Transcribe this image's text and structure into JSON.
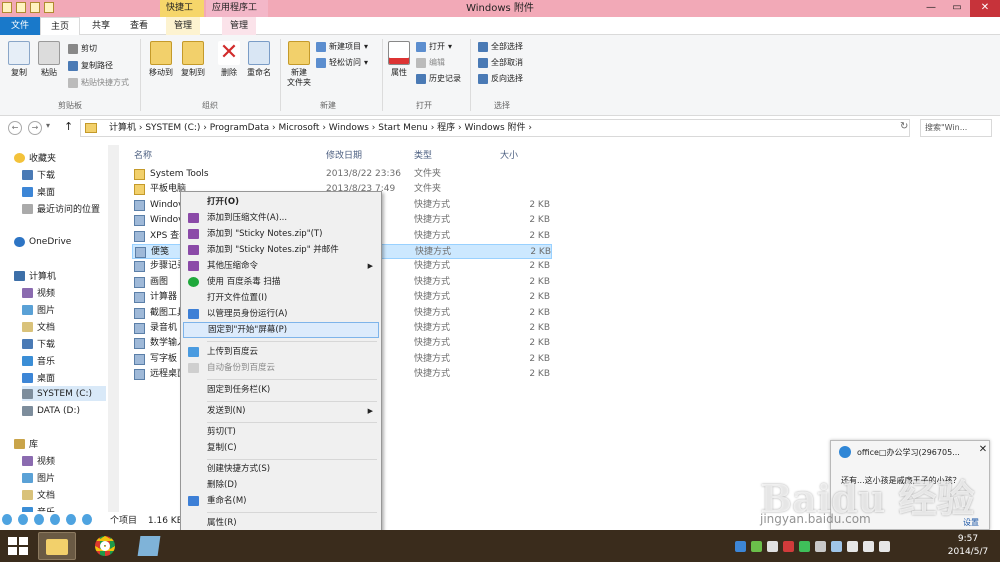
{
  "window": {
    "title": "Windows 附件",
    "context_tab_shortcut": "快捷工具",
    "context_tab_app": "应用程序工具",
    "minimize": "—",
    "restore": "▭",
    "close": "✕"
  },
  "tabs": [
    "文件",
    "主页",
    "共享",
    "查看",
    "管理",
    "管理"
  ],
  "ribbon": {
    "clipboard": {
      "copy": "复制",
      "paste": "粘贴",
      "cut": "剪切",
      "copy_path": "复制路径",
      "paste_shortcut": "粘贴快捷方式",
      "group": "剪贴板"
    },
    "organize": {
      "move_to": "移动到",
      "copy_to": "复制到",
      "delete": "删除",
      "rename": "重命名",
      "group": "组织"
    },
    "new": {
      "new_folder": "新建\n文件夹",
      "new_item": "新建项目",
      "easy_access": "轻松访问",
      "group": "新建"
    },
    "open": {
      "properties": "属性",
      "open": "打开",
      "edit": "编辑",
      "history": "历史记录",
      "group": "打开"
    },
    "select": {
      "select_all": "全部选择",
      "select_none": "全部取消",
      "invert": "反向选择",
      "group": "选择"
    }
  },
  "address": {
    "path": "计算机  ›  SYSTEM (C:)  ›  ProgramData  ›  Microsoft  ›  Windows  ›  Start Menu  ›  程序  ›  Windows 附件  ›",
    "search_placeholder": "搜索\"Win..."
  },
  "nav": {
    "favorites": "收藏夹",
    "downloads": "下载",
    "desktop": "桌面",
    "recent": "最近访问的位置",
    "onedrive": "OneDrive",
    "computer": "计算机",
    "videos": "视频",
    "pictures": "图片",
    "documents": "文档",
    "downloads2": "下载",
    "music": "音乐",
    "desktop2": "桌面",
    "system_c": "SYSTEM (C:)",
    "data_d": "DATA (D:)",
    "library": "库",
    "lib_videos": "视频",
    "lib_pictures": "图片",
    "lib_documents": "文档",
    "lib_music": "音乐"
  },
  "columns": {
    "name": "名称",
    "date": "修改日期",
    "type": "类型",
    "size": "大小"
  },
  "files": [
    {
      "name": "System Tools",
      "date": "2013/8/22 23:36",
      "type": "文件夹",
      "size": ""
    },
    {
      "name": "平板电脑",
      "date": "2013/8/23 7:49",
      "type": "文件夹",
      "size": ""
    },
    {
      "name": "Windov",
      "date": ":45",
      "type": "快捷方式",
      "size": "2 KB"
    },
    {
      "name": "Windov",
      "date": ":00",
      "type": "快捷方式",
      "size": "2 KB"
    },
    {
      "name": "XPS 查看",
      "date": ":56",
      "type": "快捷方式",
      "size": "2 KB"
    },
    {
      "name": "便笺",
      "date": ":46",
      "type": "快捷方式",
      "size": "2 KB"
    },
    {
      "name": "步骤记录",
      "date": ":52",
      "type": "快捷方式",
      "size": "2 KB"
    },
    {
      "name": "画图",
      "date": ":45",
      "type": "快捷方式",
      "size": "2 KB"
    },
    {
      "name": "计算器",
      "date": ":47",
      "type": "快捷方式",
      "size": "2 KB"
    },
    {
      "name": "截图工具",
      "date": ":01",
      "type": "快捷方式",
      "size": "2 KB"
    },
    {
      "name": "录音机",
      "date": ":52",
      "type": "快捷方式",
      "size": "2 KB"
    },
    {
      "name": "数学输入",
      "date": ":46",
      "type": "快捷方式",
      "size": "2 KB"
    },
    {
      "name": "写字板",
      "date": ":47",
      "type": "快捷方式",
      "size": "2 KB"
    },
    {
      "name": "远程桌面",
      "date": ":46",
      "type": "快捷方式",
      "size": "2 KB"
    }
  ],
  "status": {
    "count": "个项目",
    "selected": "1.16 KB"
  },
  "context_menu": {
    "open": "打开(O)",
    "add_archive": "添加到压缩文件(A)...",
    "add_zip": "添加到 \"Sticky Notes.zip\"(T)",
    "add_zip_mail": "添加到 \"Sticky Notes.zip\" 并邮件",
    "other_compress": "其他压缩命令",
    "baidu_scan": "使用 百度杀毒 扫描",
    "open_location": "打开文件位置(I)",
    "run_admin": "以管理员身份运行(A)",
    "pin_start": "固定到\"开始\"屏幕(P)",
    "upload_baidu": "上传到百度云",
    "auto_backup": "自动备份到百度云",
    "pin_taskbar": "固定到任务栏(K)",
    "send_to": "发送到(N)",
    "cut": "剪切(T)",
    "copy": "复制(C)",
    "create_shortcut": "创建快捷方式(S)",
    "delete": "删除(D)",
    "rename": "重命名(M)",
    "properties": "属性(R)"
  },
  "notification": {
    "title": "office□办公学习(296705...",
    "body": "还有...这小孩是戚廉王子的小孩？",
    "settings": "设置",
    "close": "✕"
  },
  "clock": {
    "time": "9:57",
    "date": "2014/5/7"
  },
  "watermark": {
    "brand": "Baidu 经验",
    "url": "jingyan.baidu.com"
  },
  "colors": {
    "accent": "#1979ca",
    "titlebar": "#f2a9b7",
    "selection": "#cce8ff",
    "taskbar": "#3a2c1c"
  }
}
